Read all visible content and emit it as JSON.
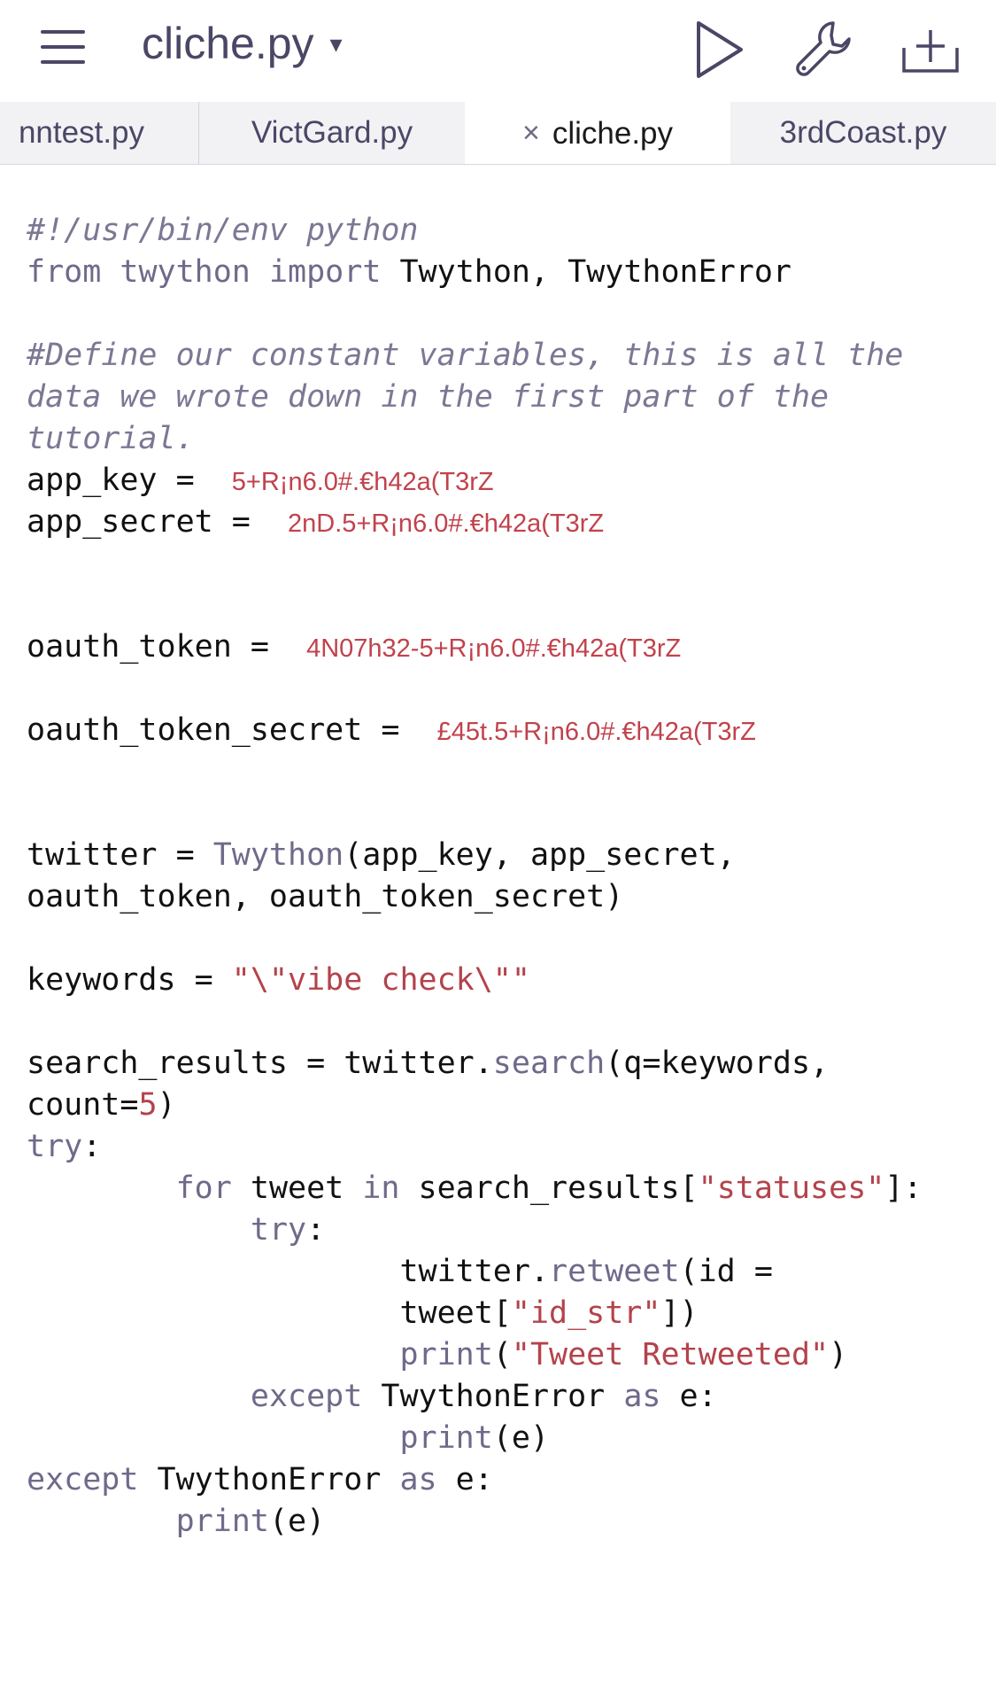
{
  "header": {
    "title": "cliche.py",
    "caret": "▾"
  },
  "tabs": [
    {
      "label": "nntest.py"
    },
    {
      "label": "VictGard.py"
    },
    {
      "label": "cliche.py",
      "close": "×"
    },
    {
      "label": "3rdCoast.py"
    }
  ],
  "code": {
    "shebang": "#!/usr/bin/env python",
    "l_import": {
      "kw1": "from",
      "mod": "twython",
      "kw2": "import",
      "names": "Twython, TwythonError"
    },
    "comment1": "#Define our constant variables, this is all the",
    "comment2": "data we wrote down in the first part of the",
    "comment3": "tutorial.",
    "app_key": {
      "lhs": "app_key = ",
      "val": "5+R¡n6.0#.€h42a(T3rZ"
    },
    "app_secret": {
      "lhs": "app_secret = ",
      "val": "2nD.5+R¡n6.0#.€h42a(T3rZ"
    },
    "oauth_token": {
      "lhs": "oauth_token = ",
      "val": "4N07h32-5+R¡n6.0#.€h42a(T3rZ"
    },
    "oauth_token_secret": {
      "lhs": "oauth_token_secret = ",
      "val": "£45t.5+R¡n6.0#.€h42a(T3rZ"
    },
    "twitter1": {
      "a": "twitter = ",
      "fn": "Twython",
      "b": "(app_key, app_secret,"
    },
    "twitter2": "oauth_token, oauth_token_secret)",
    "keywords": {
      "a": "keywords = ",
      "s": "\"\\\"vibe check\\\"\""
    },
    "search1": {
      "a": "search_results = twitter.",
      "fn": "search",
      "b": "(q=keywords,"
    },
    "search2": {
      "a": "count=",
      "n": "5",
      "b": ")"
    },
    "try1": {
      "kw": "try",
      "b": ":"
    },
    "for": {
      "ind": "        ",
      "kw1": "for",
      "a": " tweet ",
      "kw2": "in",
      "b": " search_results[",
      "s": "\"statuses\"",
      "c": "]:"
    },
    "try2": {
      "ind": "            ",
      "kw": "try",
      "b": ":"
    },
    "retweet1": {
      "ind": "                    ",
      "a": "twitter.",
      "fn": "retweet",
      "b": "(id ="
    },
    "retweet2": {
      "ind": "                    ",
      "a": "tweet[",
      "s": "\"id_str\"",
      "b": "])"
    },
    "print1": {
      "ind": "                    ",
      "fn": "print",
      "a": "(",
      "s": "\"Tweet Retweeted\"",
      "b": ")"
    },
    "except1": {
      "ind": "            ",
      "kw1": "except",
      "a": " TwythonError ",
      "kw2": "as",
      "b": " e:"
    },
    "print2": {
      "ind": "                    ",
      "fn": "print",
      "a": "(e)"
    },
    "except2": {
      "kw1": "except",
      "a": " TwythonError ",
      "kw2": "as",
      "b": " e:"
    },
    "print3": {
      "ind": "        ",
      "fn": "print",
      "a": "(e)"
    }
  }
}
